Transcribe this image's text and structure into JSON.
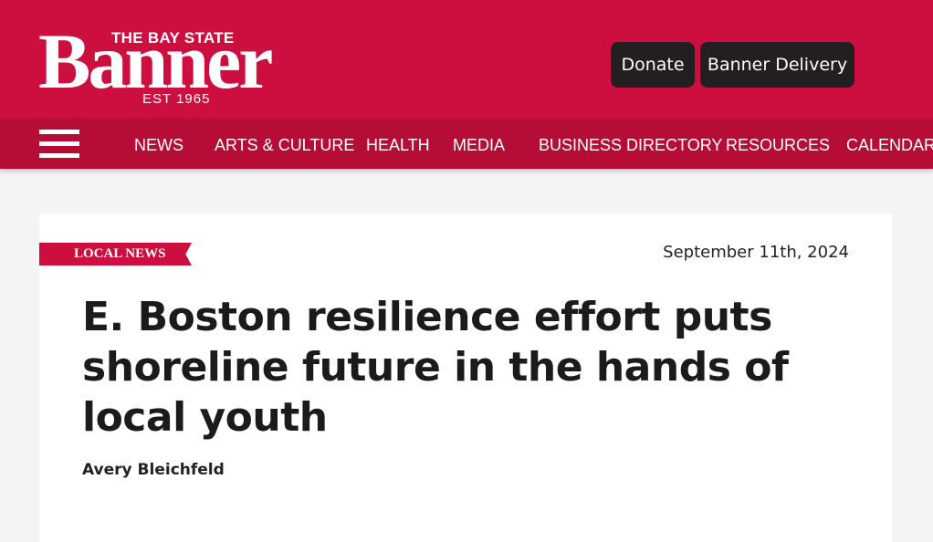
{
  "header": {
    "logo": {
      "top_text": "THE BAY STATE",
      "main_text": "Banner",
      "est_text": "EST  1965"
    },
    "buttons": {
      "donate": "Donate",
      "delivery": "Banner Delivery"
    }
  },
  "nav": {
    "menu_icon": "hamburger-menu-icon",
    "items": [
      "NEWS",
      "ARTS & CULTURE",
      "HEALTH",
      "MEDIA",
      "BUSINESS DIRECTORY",
      "RESOURCES",
      "CALENDAR"
    ]
  },
  "article": {
    "category": "LOCAL NEWS",
    "date": "September 11th, 2024",
    "title": "E. Boston resilience effort puts shoreline future in the hands of local youth",
    "author": "Avery Bleichfeld"
  },
  "colors": {
    "brand_red": "#cc0f3f",
    "nav_red": "#b60d36",
    "button_dark": "#231f20"
  }
}
